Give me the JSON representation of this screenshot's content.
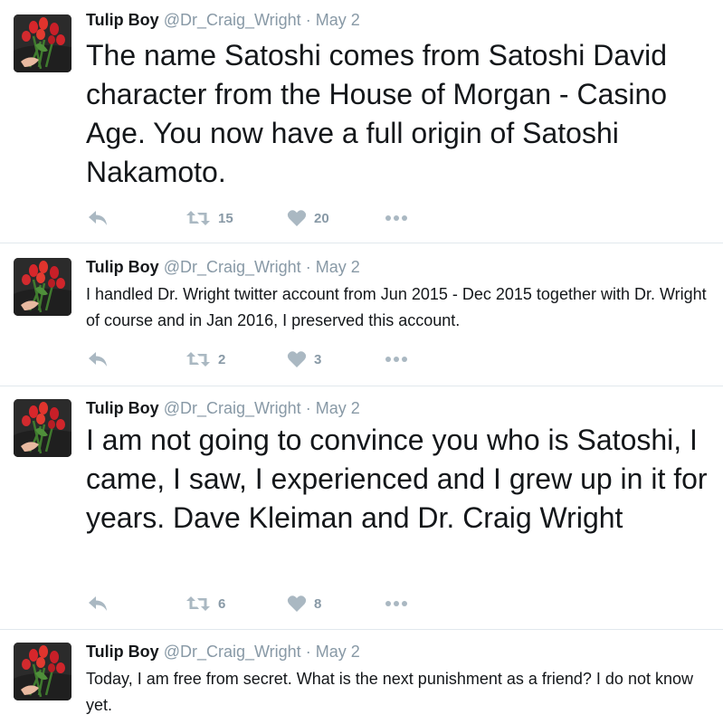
{
  "colors": {
    "text": "#14171a",
    "muted": "#8899a6",
    "icon": "#aab8c2",
    "divider": "#e1e8ed"
  },
  "tweets": [
    {
      "name": "Tulip Boy",
      "handle": "@Dr_Craig_Wright",
      "separator": "·",
      "date": "May 2",
      "text": "The name Satoshi comes from Satoshi David character from the House of Morgan - Casino Age. You now have a full origin of Satoshi Nakamoto.",
      "retweets": "15",
      "likes": "20"
    },
    {
      "name": "Tulip Boy",
      "handle": "@Dr_Craig_Wright",
      "separator": "·",
      "date": "May 2",
      "text": "I handled Dr. Wright twitter account from Jun 2015 - Dec 2015 together with Dr. Wright of course and in Jan 2016, I preserved this account.",
      "retweets": "2",
      "likes": "3"
    },
    {
      "name": "Tulip Boy",
      "handle": "@Dr_Craig_Wright",
      "separator": "·",
      "date": "May 2",
      "text": "I am not going to convince you who is Satoshi, I came, I saw, I experienced and I grew up in it for years. Dave Kleiman and Dr. Craig Wright",
      "retweets": "6",
      "likes": "8"
    },
    {
      "name": "Tulip Boy",
      "handle": "@Dr_Craig_Wright",
      "separator": "·",
      "date": "May 2",
      "text": "Today, I am free from secret. What is the next punishment as a friend? I do not know yet."
    }
  ]
}
